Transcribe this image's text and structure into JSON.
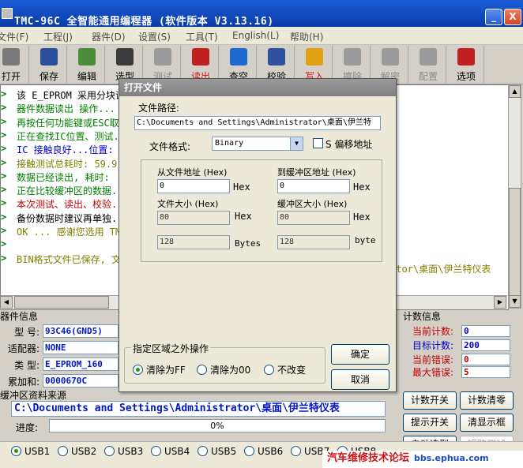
{
  "window": {
    "title": "TMC-96C 全智能通用编程器 (软件版本 V3.13.16)",
    "min_glyph": "_",
    "close_glyph": "X"
  },
  "menu": [
    "文件(F)",
    "工程(J)",
    "器件(D)",
    "设置(S)",
    "工具(T)",
    "English(L)",
    "帮助(H)"
  ],
  "toolbar": [
    {
      "label": "打开",
      "icon": "folder-open-icon",
      "state": "normal",
      "color": "#7a7a7a"
    },
    {
      "label": "保存",
      "icon": "floppy-disk-icon",
      "state": "normal",
      "color": "#2b4d9e"
    },
    {
      "label": "编辑",
      "icon": "edit-notepad-icon",
      "state": "normal",
      "color": "#4c8c3a"
    },
    {
      "label": "选型",
      "icon": "chip-icon",
      "state": "normal",
      "color": "#3a3a3a"
    },
    {
      "label": "测试",
      "icon": "test-probe-icon",
      "state": "disabled",
      "color": "#9a9a9a"
    },
    {
      "label": "读出",
      "icon": "read-chip-icon",
      "state": "hot",
      "color": "#c02020"
    },
    {
      "label": "查空",
      "icon": "magnifier-icon",
      "state": "normal",
      "color": "#1a6ad0"
    },
    {
      "label": "校验",
      "icon": "verify-chip-icon",
      "state": "normal",
      "color": "#3050a0"
    },
    {
      "label": "写入",
      "icon": "lightning-write-icon",
      "state": "hot",
      "color": "#e0a010"
    },
    {
      "label": "擦除",
      "icon": "eraser-icon",
      "state": "disabled",
      "color": "#9a9a9a"
    },
    {
      "label": "解密",
      "icon": "decrypt-icon",
      "state": "disabled",
      "color": "#9a9a9a"
    },
    {
      "label": "配置",
      "icon": "config-icon",
      "state": "disabled",
      "color": "#9a9a9a"
    },
    {
      "label": "选项",
      "icon": "checklist-icon",
      "state": "normal",
      "color": "#c02020"
    }
  ],
  "log": [
    {
      "text": "该 E_EPROM 采用分块读写...",
      "color": "#000000"
    },
    {
      "text": "器件数据读出 操作...",
      "color": "#008000"
    },
    {
      "text": "再按任何功能键或ESC取消...",
      "color": "#008000"
    },
    {
      "text": "正在查找IC位置、测试...",
      "color": "#008000"
    },
    {
      "text": "IC 接触良好...位置:",
      "color": "#0000c8"
    },
    {
      "text": "接触测试总耗时: 59.9",
      "color": "#808000"
    },
    {
      "text": "数据已经读出, 耗时:",
      "color": "#008000"
    },
    {
      "text": "正在比较缓冲区的数据...",
      "color": "#008000"
    },
    {
      "text": "本次测试、读出、校验...",
      "color": "#c00000"
    },
    {
      "text": "备份数据时建议再单独...",
      "color": "#000000"
    },
    {
      "text": "OK ... 感谢您选用 TM",
      "color": "#808000"
    },
    {
      "text": "",
      "color": "#000000"
    },
    {
      "text": "BIN格式文件已保存, 文",
      "color": "#808000"
    }
  ],
  "log_tail": "ator\\桌面\\伊兰特仪表",
  "device": {
    "group_title": "器件信息",
    "rows": [
      {
        "key": "型 号:",
        "value": "93C46(GND5)"
      },
      {
        "key": "适配器:",
        "value": "NONE"
      },
      {
        "key": "类 型:",
        "value": "E_EPROM_160"
      },
      {
        "key": "累加和:",
        "value": "0000670C"
      }
    ]
  },
  "buffer_source": {
    "group_title": "缓冲区资料来源",
    "path": "C:\\Documents and Settings\\Administrator\\桌面\\伊兰特仪表"
  },
  "progress": {
    "label": "进度:",
    "text": "0%",
    "percent": 0
  },
  "counters": {
    "group_title": "计数信息",
    "rows": [
      {
        "key": "当前计数:",
        "value": "0",
        "key_color": "#c00000",
        "value_color": "#0000c8"
      },
      {
        "key": "目标计数:",
        "value": "200",
        "key_color": "#0000c8",
        "value_color": "#0000c8"
      },
      {
        "key": "当前错误:",
        "value": "0",
        "key_color": "#c00000",
        "value_color": "#c00000"
      },
      {
        "key": "最大错误:",
        "value": "5",
        "key_color": "#c00000",
        "value_color": "#c00000"
      }
    ]
  },
  "side_buttons": [
    {
      "label": "计数开关",
      "disabled": false
    },
    {
      "label": "计数清零",
      "disabled": false
    },
    {
      "label": "提示开关",
      "disabled": false
    },
    {
      "label": "清显示框",
      "disabled": false
    },
    {
      "label": "自动选型",
      "disabled": false
    },
    {
      "label": "短路测试",
      "disabled": true
    }
  ],
  "usb_ports": [
    {
      "label": "USB1",
      "selected": true
    },
    {
      "label": "USB2",
      "selected": false
    },
    {
      "label": "USB3",
      "selected": false
    },
    {
      "label": "USB4",
      "selected": false
    },
    {
      "label": "USB5",
      "selected": false
    },
    {
      "label": "USB6",
      "selected": false
    },
    {
      "label": "USB7",
      "selected": false
    },
    {
      "label": "USB8",
      "selected": false
    }
  ],
  "watermark": {
    "text": "汽车维修技术论坛",
    "url": "bbs.ephua.com"
  },
  "dialog": {
    "title": "打开文件",
    "path_label": "文件路径:",
    "path_value": "C:\\Documents and Settings\\Administrator\\桌面\\伊兰特",
    "format_label": "文件格式:",
    "format_value": "Binary",
    "offset_checkbox_label": "S 偏移地址",
    "offset_checked": false,
    "from_addr_label": "从文件地址 (Hex)",
    "from_addr_value": "0",
    "from_addr_unit": "Hex",
    "to_buf_label": "到缓冲区地址 (Hex)",
    "to_buf_value": "0",
    "to_buf_unit": "Hex",
    "file_size_label": "文件大小 (Hex)",
    "file_size_value": "80",
    "file_size_unit": "Hex",
    "buf_size_label": "缓冲区大小 (Hex)",
    "buf_size_value": "80",
    "buf_size_unit": "Hex",
    "file_bytes_value": "128",
    "file_bytes_unit": "Bytes",
    "buf_bytes_value": "128",
    "buf_bytes_unit": "byte",
    "range_group_label": "指定区域之外操作",
    "range_options": [
      {
        "label": "清除为FF",
        "selected": true
      },
      {
        "label": "清除为00",
        "selected": false
      },
      {
        "label": "不改变",
        "selected": false
      }
    ],
    "ok_label": "确定",
    "cancel_label": "取消"
  }
}
